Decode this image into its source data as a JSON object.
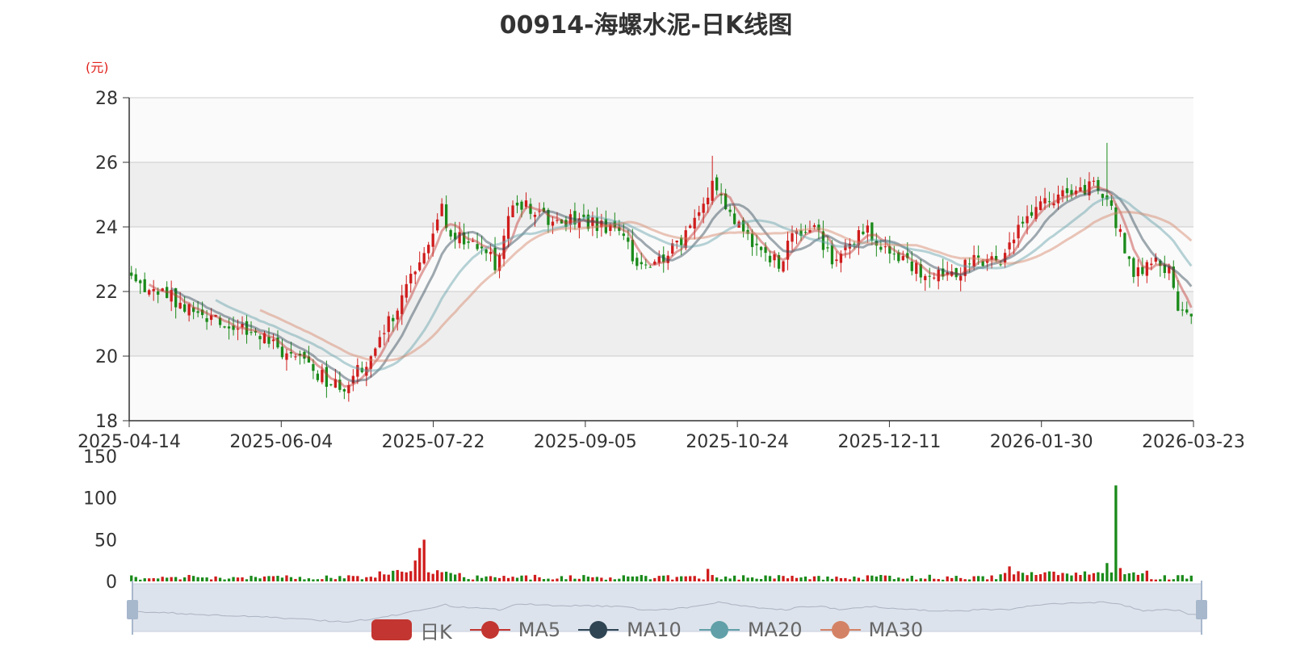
{
  "title": "00914-海螺水泥-日K线图",
  "unit_label": "(元)",
  "chart_data": {
    "type": "candlestick",
    "x_ticks": [
      "2025-04-14",
      "2025-06-04",
      "2025-07-22",
      "2025-09-05",
      "2025-10-24",
      "2025-12-11",
      "2026-01-30",
      "2026-03-23"
    ],
    "price_ylim": [
      18,
      28
    ],
    "price_yticks": [
      18,
      20,
      22,
      24,
      26,
      28
    ],
    "volume_ylim": [
      0,
      150
    ],
    "volume_yticks": [
      0,
      50,
      100,
      150
    ],
    "trading_days": 240,
    "price_anchors": [
      [
        0,
        22.4
      ],
      [
        12,
        21.6
      ],
      [
        20,
        21.0
      ],
      [
        30,
        20.6
      ],
      [
        40,
        19.6
      ],
      [
        48,
        18.9
      ],
      [
        53,
        19.9
      ],
      [
        60,
        21.5
      ],
      [
        66,
        23.2
      ],
      [
        70,
        24.6
      ],
      [
        72,
        23.7
      ],
      [
        78,
        23.4
      ],
      [
        82,
        22.9
      ],
      [
        86,
        24.6
      ],
      [
        90,
        24.6
      ],
      [
        95,
        24.0
      ],
      [
        100,
        24.3
      ],
      [
        108,
        24.0
      ],
      [
        114,
        23.0
      ],
      [
        120,
        23.0
      ],
      [
        124,
        23.5
      ],
      [
        128,
        24.3
      ],
      [
        131,
        25.4
      ],
      [
        134,
        24.4
      ],
      [
        140,
        23.6
      ],
      [
        146,
        22.8
      ],
      [
        150,
        23.9
      ],
      [
        154,
        23.9
      ],
      [
        158,
        23.0
      ],
      [
        162,
        23.6
      ],
      [
        166,
        23.8
      ],
      [
        172,
        23.0
      ],
      [
        178,
        22.6
      ],
      [
        184,
        22.4
      ],
      [
        190,
        22.9
      ],
      [
        196,
        22.9
      ],
      [
        202,
        24.3
      ],
      [
        206,
        24.9
      ],
      [
        210,
        25.0
      ],
      [
        214,
        25.2
      ],
      [
        218,
        25.3
      ],
      [
        222,
        24.2
      ],
      [
        226,
        22.6
      ],
      [
        230,
        22.9
      ],
      [
        234,
        22.6
      ],
      [
        236,
        21.4
      ],
      [
        240,
        21.0
      ]
    ],
    "volume_spikes": [
      [
        64,
        25
      ],
      [
        65,
        40
      ],
      [
        66,
        50
      ],
      [
        130,
        15
      ],
      [
        198,
        18
      ],
      [
        220,
        22
      ],
      [
        222,
        115
      ],
      [
        223,
        16
      ]
    ],
    "series": [
      {
        "name": "日K",
        "color": "#c23531"
      },
      {
        "name": "MA5",
        "color": "#c23531"
      },
      {
        "name": "MA10",
        "color": "#2f4554"
      },
      {
        "name": "MA20",
        "color": "#61a0a8"
      },
      {
        "name": "MA30",
        "color": "#d48265"
      }
    ],
    "up_color": "#d01c1c",
    "down_color": "#1a8a1a"
  },
  "legend": [
    {
      "label": "日K",
      "color": "#c23531"
    },
    {
      "label": "MA5",
      "color": "#c23531"
    },
    {
      "label": "MA10",
      "color": "#2f4554"
    },
    {
      "label": "MA20",
      "color": "#61a0a8"
    },
    {
      "label": "MA30",
      "color": "#d48265"
    }
  ]
}
